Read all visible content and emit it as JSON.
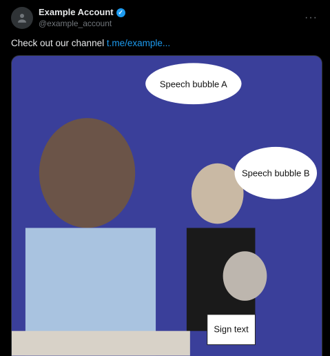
{
  "post": {
    "display_name": "Example Account",
    "handle": "@example_account",
    "more_label": "···",
    "text": "Check out our channel",
    "link_text": "t.me/example..."
  },
  "media": {
    "bubbles": [
      "Speech bubble A",
      "Speech bubble B"
    ],
    "sign": "Sign text"
  },
  "colors": {
    "background": "#000000",
    "accent": "#1d9bf0",
    "muted": "#71767b",
    "panel": "#3a3f9a"
  }
}
